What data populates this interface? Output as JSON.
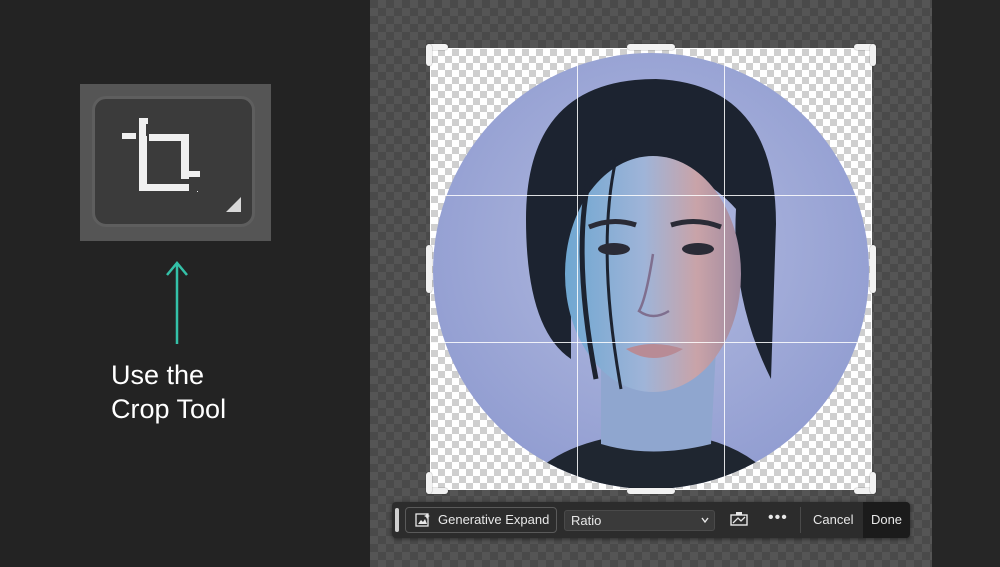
{
  "annotation": {
    "caption_line1": "Use the",
    "caption_line2": "Crop Tool",
    "arrow_color": "#34c1a8"
  },
  "toolbar": {
    "tool_icon": "crop-icon"
  },
  "options_bar": {
    "generative_expand_label": "Generative Expand",
    "ratio_value": "Ratio",
    "more_label": "•••",
    "cancel_label": "Cancel",
    "done_label": "Done"
  },
  "colors": {
    "background": "#232323",
    "options_bar": "#2c2c2c",
    "accent_arrow": "#34c1a8"
  }
}
